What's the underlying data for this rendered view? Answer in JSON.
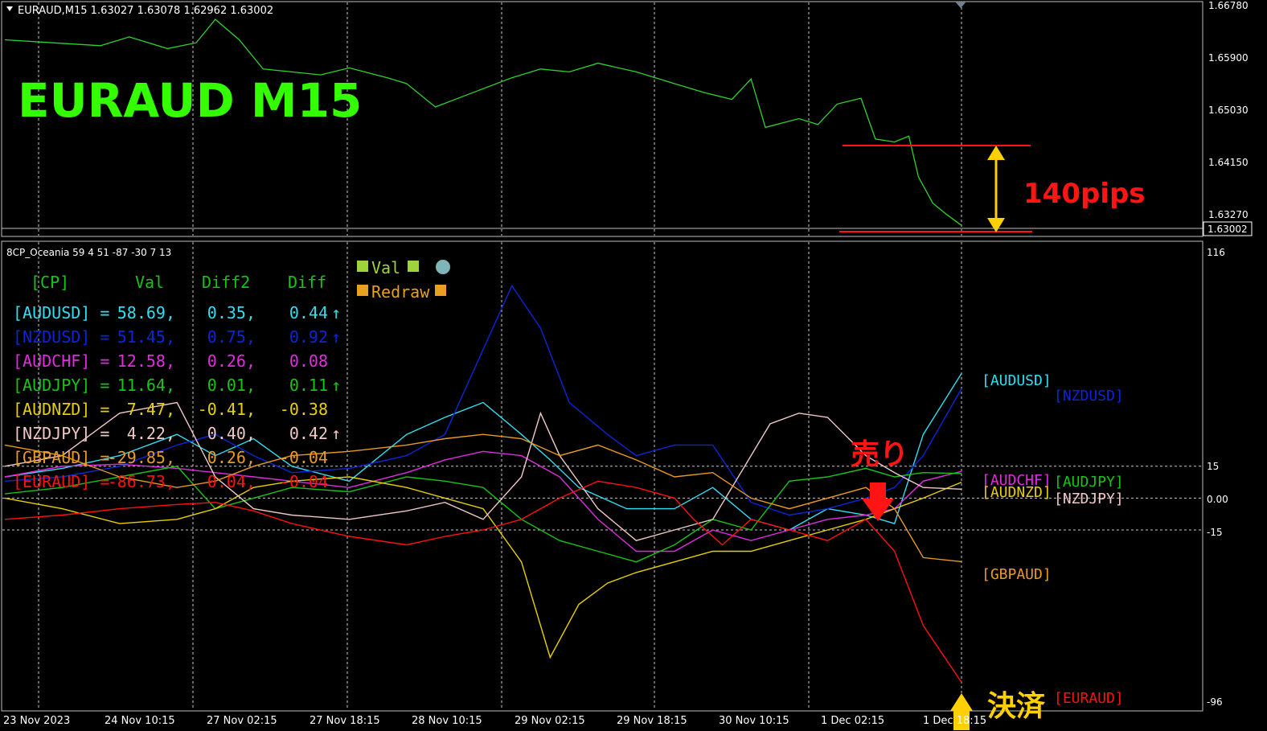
{
  "colors": {
    "background": "#000000",
    "axis": "#c0c0c0",
    "grid": "#c8c8c8",
    "price_line": "#2fd12f",
    "big_title": "#33ff00",
    "annotation_red": "#ff1414",
    "annotation_yellow": "#ffd000",
    "AUDUSD": "#33ddf0",
    "NZDUSD": "#0b26d8",
    "AUDCHF": "#e02ce0",
    "AUDJPY": "#18c418",
    "AUDNZD": "#e8d000",
    "NZDJPY": "#f0c8c8",
    "GBPAUD": "#e89a22",
    "EURAUD": "#ff1010"
  },
  "header": {
    "menu_icon": "triangle-down-icon",
    "symbol_text": "EURAUD,M15  1.63027 1.63078 1.62962 1.63002"
  },
  "price_panel": {
    "big_title": "EURAUD  M15",
    "pips_label": "140pips",
    "current_price": "1.63002",
    "axis_ticks": [
      "1.66780",
      "1.65900",
      "1.65030",
      "1.64150",
      "1.63270"
    ]
  },
  "indicator_panel": {
    "title": "8CP_Oceania 59 4 51 -87 -30 7 13",
    "axis_ticks": [
      "116",
      "15",
      "0.00",
      "-15",
      "-96"
    ],
    "legend": {
      "val": "Val",
      "redraw": "Redraw"
    },
    "table_headers": [
      "[CP]",
      "Val",
      "Diff2",
      "Diff"
    ],
    "table_rows": [
      {
        "pair": "[AUDUSD]",
        "val": "58.69,",
        "diff2": "0.35,",
        "diff": "0.44",
        "arrow": "↑",
        "color_key": "AUDUSD"
      },
      {
        "pair": "[NZDUSD]",
        "val": "51.45,",
        "diff2": "0.75,",
        "diff": "0.92",
        "arrow": "↑",
        "color_key": "NZDUSD"
      },
      {
        "pair": "[AUDCHF]",
        "val": "12.58,",
        "diff2": "0.26,",
        "diff": "0.08",
        "arrow": "",
        "color_key": "AUDCHF"
      },
      {
        "pair": "[AUDJPY]",
        "val": "11.64,",
        "diff2": "0.01,",
        "diff": "0.11",
        "arrow": "↑",
        "color_key": "AUDJPY"
      },
      {
        "pair": "[AUDNZD]",
        "val": "7.47,",
        "diff2": "-0.41,",
        "diff": "-0.38",
        "arrow": "",
        "color_key": "AUDNZD"
      },
      {
        "pair": "[NZDJPY]",
        "val": "4.22,",
        "diff2": "0.40,",
        "diff": "0.42",
        "arrow": "↑",
        "color_key": "NZDJPY"
      },
      {
        "pair": "[GBPAUD]",
        "val": "-29.85,",
        "diff2": "0.26,",
        "diff": "-0.04",
        "arrow": "",
        "color_key": "GBPAUD"
      },
      {
        "pair": "[EURAUD]",
        "val": "-86.73,",
        "diff2": "0.04,",
        "diff": "-0.04",
        "arrow": "",
        "color_key": "EURAUD"
      }
    ],
    "sell_label": "売り",
    "settle_label": "決済"
  },
  "time_axis": [
    "23 Nov 2023",
    "24 Nov 10:15",
    "27 Nov 02:15",
    "27 Nov 18:15",
    "28 Nov 10:15",
    "29 Nov 02:15",
    "29 Nov 18:15",
    "30 Nov 10:15",
    "1 Dec 02:15",
    "1 Dec 18:15"
  ],
  "chart_data": [
    {
      "type": "line",
      "title": "EURAUD  M15",
      "x": [
        "23 Nov 2023",
        "24 Nov 10:15",
        "27 Nov 02:15",
        "27 Nov 18:15",
        "28 Nov 10:15",
        "29 Nov 02:15",
        "29 Nov 18:15",
        "30 Nov 10:15",
        "1 Dec 02:15",
        "1 Dec 18:15"
      ],
      "series": [
        {
          "name": "EURAUD",
          "values": [
            [
              0,
              1.662
            ],
            [
              0.5,
              1.6615
            ],
            [
              1,
              1.661
            ],
            [
              1.3,
              1.6625
            ],
            [
              1.7,
              1.6605
            ],
            [
              2,
              1.6615
            ],
            [
              2.2,
              1.6655
            ],
            [
              2.45,
              1.662
            ],
            [
              2.7,
              1.657
            ],
            [
              3,
              1.6565
            ],
            [
              3.3,
              1.656
            ],
            [
              3.6,
              1.6572
            ],
            [
              4,
              1.6555
            ],
            [
              4.2,
              1.6545
            ],
            [
              4.5,
              1.6505
            ],
            [
              4.9,
              1.653
            ],
            [
              5.3,
              1.6555
            ],
            [
              5.6,
              1.657
            ],
            [
              5.9,
              1.6565
            ],
            [
              6.2,
              1.658
            ],
            [
              6.6,
              1.6565
            ],
            [
              7,
              1.6545
            ],
            [
              7.3,
              1.653
            ],
            [
              7.6,
              1.6518
            ],
            [
              7.8,
              1.6553
            ],
            [
              7.95,
              1.647
            ],
            [
              8.3,
              1.6485
            ],
            [
              8.5,
              1.6475
            ],
            [
              8.7,
              1.651
            ],
            [
              8.95,
              1.652
            ],
            [
              9.1,
              1.645
            ],
            [
              9.3,
              1.6445
            ],
            [
              9.45,
              1.6455
            ],
            [
              9.55,
              1.6385
            ],
            [
              9.7,
              1.634
            ],
            [
              9.85,
              1.632
            ],
            [
              10,
              1.6302
            ]
          ]
        }
      ],
      "ylim": [
        1.629,
        1.668
      ],
      "annotations": [
        "140pips"
      ],
      "grid": true
    },
    {
      "type": "line",
      "title": "8CP_Oceania 59 4 51 -87 -30 7 13",
      "x": [
        "23 Nov 2023",
        "24 Nov 10:15",
        "27 Nov 02:15",
        "27 Nov 18:15",
        "28 Nov 10:15",
        "29 Nov 02:15",
        "29 Nov 18:15",
        "30 Nov 10:15",
        "1 Dec 02:15",
        "1 Dec 18:15"
      ],
      "ylim": [
        -96,
        116
      ],
      "grid": true,
      "series": [
        {
          "name": "AUDUSD",
          "values": [
            [
              0,
              10
            ],
            [
              0.6,
              14
            ],
            [
              1.2,
              20
            ],
            [
              1.8,
              30
            ],
            [
              2.2,
              20
            ],
            [
              2.6,
              28
            ],
            [
              3,
              15
            ],
            [
              3.6,
              8
            ],
            [
              4.2,
              30
            ],
            [
              4.6,
              38
            ],
            [
              5,
              45
            ],
            [
              5.4,
              30
            ],
            [
              5.7,
              18
            ],
            [
              6,
              5
            ],
            [
              6.5,
              -5
            ],
            [
              7,
              -5
            ],
            [
              7.4,
              5
            ],
            [
              7.8,
              -10
            ],
            [
              8.2,
              -15
            ],
            [
              8.6,
              -5
            ],
            [
              9,
              -8
            ],
            [
              9.3,
              -12
            ],
            [
              9.6,
              30
            ],
            [
              10,
              58.7
            ]
          ]
        },
        {
          "name": "NZDUSD",
          "values": [
            [
              0,
              8
            ],
            [
              0.6,
              10
            ],
            [
              1.2,
              15
            ],
            [
              1.8,
              25
            ],
            [
              2.2,
              30
            ],
            [
              2.6,
              20
            ],
            [
              3,
              12
            ],
            [
              3.6,
              14
            ],
            [
              4.2,
              20
            ],
            [
              4.6,
              30
            ],
            [
              5,
              70
            ],
            [
              5.3,
              100
            ],
            [
              5.6,
              80
            ],
            [
              5.9,
              45
            ],
            [
              6.3,
              30
            ],
            [
              6.6,
              20
            ],
            [
              7,
              25
            ],
            [
              7.4,
              25
            ],
            [
              7.8,
              -2
            ],
            [
              8.2,
              -8
            ],
            [
              8.6,
              -5
            ],
            [
              9,
              0
            ],
            [
              9.3,
              5
            ],
            [
              9.6,
              20
            ],
            [
              10,
              51.5
            ]
          ]
        },
        {
          "name": "AUDCHF",
          "values": [
            [
              0,
              10
            ],
            [
              0.6,
              15
            ],
            [
              1.2,
              16
            ],
            [
              1.8,
              14
            ],
            [
              2.2,
              12
            ],
            [
              2.6,
              10
            ],
            [
              3,
              8
            ],
            [
              3.6,
              5
            ],
            [
              4.2,
              12
            ],
            [
              4.6,
              18
            ],
            [
              5,
              22
            ],
            [
              5.4,
              20
            ],
            [
              5.8,
              10
            ],
            [
              6.2,
              -10
            ],
            [
              6.6,
              -25
            ],
            [
              7,
              -25
            ],
            [
              7.4,
              -15
            ],
            [
              7.8,
              -20
            ],
            [
              8.2,
              -15
            ],
            [
              8.6,
              -10
            ],
            [
              9,
              -8
            ],
            [
              9.3,
              -5
            ],
            [
              9.6,
              8
            ],
            [
              10,
              12.6
            ]
          ]
        },
        {
          "name": "AUDJPY",
          "values": [
            [
              0,
              2
            ],
            [
              0.6,
              5
            ],
            [
              1.2,
              10
            ],
            [
              1.8,
              15
            ],
            [
              2.2,
              -5
            ],
            [
              2.6,
              0
            ],
            [
              3,
              5
            ],
            [
              3.6,
              3
            ],
            [
              4.2,
              10
            ],
            [
              4.6,
              8
            ],
            [
              5,
              5
            ],
            [
              5.4,
              -10
            ],
            [
              5.8,
              -20
            ],
            [
              6.2,
              -25
            ],
            [
              6.6,
              -30
            ],
            [
              7,
              -22
            ],
            [
              7.4,
              -10
            ],
            [
              7.8,
              -15
            ],
            [
              8.2,
              8
            ],
            [
              8.6,
              10
            ],
            [
              9,
              14
            ],
            [
              9.3,
              10
            ],
            [
              9.6,
              12
            ],
            [
              10,
              11.6
            ]
          ]
        },
        {
          "name": "AUDNZD",
          "values": [
            [
              0,
              0
            ],
            [
              0.6,
              -5
            ],
            [
              1.2,
              -12
            ],
            [
              1.8,
              -10
            ],
            [
              2.2,
              -5
            ],
            [
              2.6,
              5
            ],
            [
              3,
              8
            ],
            [
              3.6,
              10
            ],
            [
              4.2,
              5
            ],
            [
              4.6,
              0
            ],
            [
              5,
              -5
            ],
            [
              5.4,
              -30
            ],
            [
              5.7,
              -75
            ],
            [
              6,
              -50
            ],
            [
              6.3,
              -40
            ],
            [
              6.6,
              -35
            ],
            [
              7,
              -30
            ],
            [
              7.4,
              -25
            ],
            [
              7.8,
              -25
            ],
            [
              8.2,
              -20
            ],
            [
              8.6,
              -15
            ],
            [
              9,
              -10
            ],
            [
              9.3,
              -5
            ],
            [
              9.6,
              0
            ],
            [
              10,
              7.5
            ]
          ]
        },
        {
          "name": "NZDJPY",
          "values": [
            [
              0,
              15
            ],
            [
              0.6,
              20
            ],
            [
              1.2,
              40
            ],
            [
              1.8,
              45
            ],
            [
              2.2,
              10
            ],
            [
              2.6,
              -5
            ],
            [
              3,
              -8
            ],
            [
              3.6,
              -10
            ],
            [
              4.2,
              -6
            ],
            [
              4.6,
              -2
            ],
            [
              5,
              -10
            ],
            [
              5.4,
              10
            ],
            [
              5.6,
              40
            ],
            [
              5.8,
              20
            ],
            [
              6.2,
              -5
            ],
            [
              6.6,
              -20
            ],
            [
              7,
              -15
            ],
            [
              7.4,
              -10
            ],
            [
              7.8,
              20
            ],
            [
              8,
              35
            ],
            [
              8.3,
              40
            ],
            [
              8.6,
              38
            ],
            [
              9,
              20
            ],
            [
              9.3,
              12
            ],
            [
              9.6,
              5
            ],
            [
              10,
              4.2
            ]
          ]
        },
        {
          "name": "GBPAUD",
          "values": [
            [
              0,
              25
            ],
            [
              0.6,
              20
            ],
            [
              1.2,
              10
            ],
            [
              1.8,
              5
            ],
            [
              2.2,
              8
            ],
            [
              2.6,
              15
            ],
            [
              3,
              20
            ],
            [
              3.6,
              22
            ],
            [
              4.2,
              25
            ],
            [
              4.6,
              28
            ],
            [
              5,
              30
            ],
            [
              5.4,
              28
            ],
            [
              5.8,
              20
            ],
            [
              6.2,
              25
            ],
            [
              6.6,
              18
            ],
            [
              7,
              10
            ],
            [
              7.4,
              12
            ],
            [
              7.8,
              0
            ],
            [
              8.2,
              -5
            ],
            [
              8.6,
              0
            ],
            [
              9,
              5
            ],
            [
              9.3,
              -5
            ],
            [
              9.6,
              -28
            ],
            [
              10,
              -29.9
            ]
          ]
        },
        {
          "name": "EURAUD",
          "values": [
            [
              0,
              -10
            ],
            [
              0.6,
              -8
            ],
            [
              1.2,
              -5
            ],
            [
              1.8,
              -3
            ],
            [
              2.2,
              -2
            ],
            [
              2.6,
              -6
            ],
            [
              3,
              -12
            ],
            [
              3.6,
              -18
            ],
            [
              4.2,
              -22
            ],
            [
              4.6,
              -18
            ],
            [
              5,
              -15
            ],
            [
              5.4,
              -10
            ],
            [
              5.8,
              0
            ],
            [
              6.2,
              8
            ],
            [
              6.6,
              5
            ],
            [
              7,
              0
            ],
            [
              7.2,
              -10
            ],
            [
              7.5,
              -22
            ],
            [
              7.8,
              -10
            ],
            [
              8.2,
              -15
            ],
            [
              8.6,
              -20
            ],
            [
              9,
              -10
            ],
            [
              9.3,
              -25
            ],
            [
              9.6,
              -60
            ],
            [
              10,
              -86.7
            ]
          ]
        }
      ]
    }
  ]
}
